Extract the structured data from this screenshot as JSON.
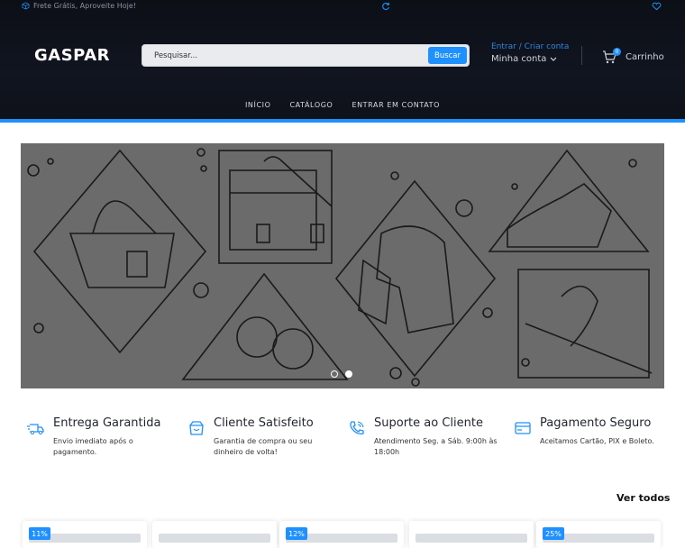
{
  "topbar": {
    "promo_text": "Frete Grátis, Aproveite Hoje!"
  },
  "brand": {
    "logo_text": "GASPAR"
  },
  "search": {
    "placeholder": "Pesquisar...",
    "button_label": "Buscar"
  },
  "account": {
    "login_text": "Entrar / Criar conta",
    "my_account": "Minha conta"
  },
  "cart": {
    "label": "Carrinho",
    "count": "0"
  },
  "nav": {
    "items": [
      "INÍCIO",
      "CATÁLOGO",
      "ENTRAR EM CONTATO"
    ]
  },
  "banner": {
    "slides": 2,
    "active_slide": 2
  },
  "features": [
    {
      "icon": "fast-delivery-icon",
      "title": "Entrega Garantida",
      "text": "Envio imediato após o pagamento."
    },
    {
      "icon": "satisfied-box-icon",
      "title": "Cliente Satisfeito",
      "text": "Garantia de compra ou seu dinheiro de volta!"
    },
    {
      "icon": "phone-support-icon",
      "title": "Suporte ao Cliente",
      "text": "Atendimento Seg. a Sáb. 9:00h às 18:00h"
    },
    {
      "icon": "credit-card-icon",
      "title": "Pagamento Seguro",
      "text": "Aceitamos Cartão, PIX e Boleto."
    }
  ],
  "products": {
    "see_all": "Ver todos",
    "discounts": [
      "11%",
      "",
      "12%",
      "",
      "25%"
    ]
  },
  "colors": {
    "accent": "#1e90ff",
    "header_bg": "#0e1118",
    "banner_bg": "#6b6b6b"
  }
}
